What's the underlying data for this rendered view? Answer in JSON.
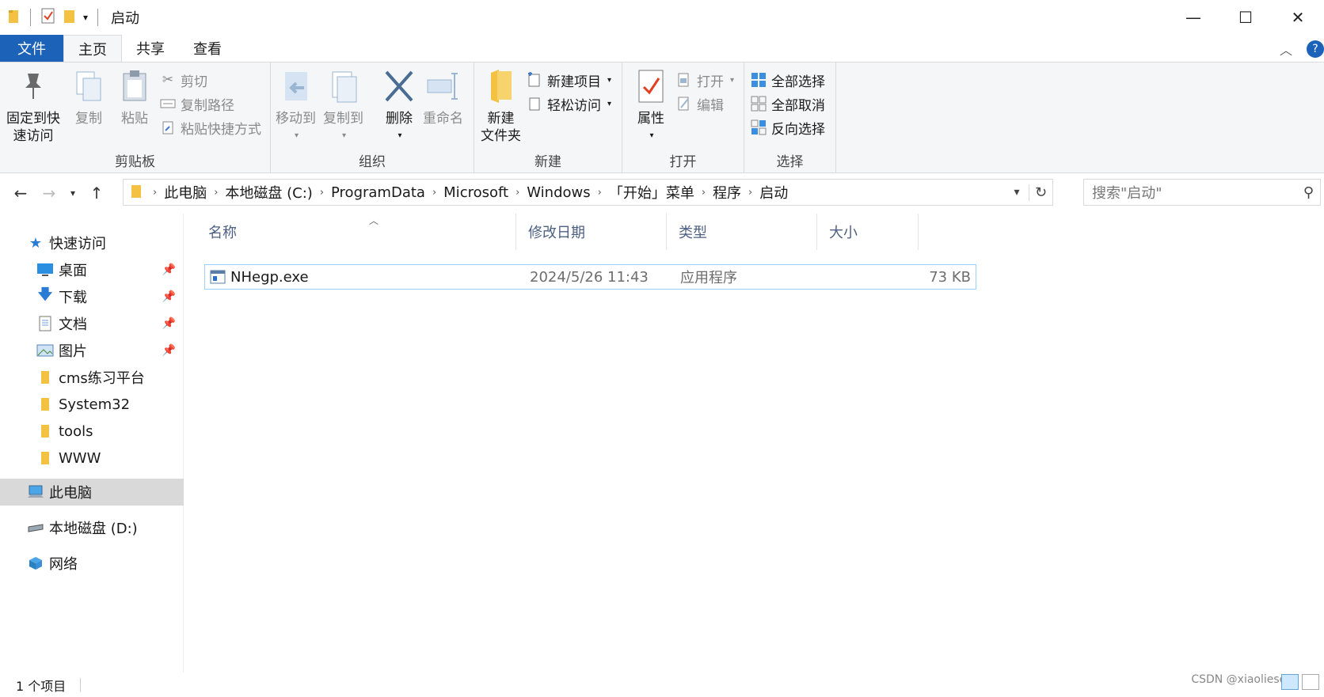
{
  "window": {
    "title": "启动",
    "controls": {
      "minimize": "—",
      "maximize": "☐",
      "close": "✕"
    }
  },
  "tabs": [
    {
      "label": "文件"
    },
    {
      "label": "主页"
    },
    {
      "label": "共享"
    },
    {
      "label": "查看"
    }
  ],
  "help": "?",
  "ribbon": {
    "clipboard": {
      "label": "剪贴板",
      "pin": "固定到快速访问",
      "pin_line1": "固定到快",
      "pin_line2": "速访问",
      "copy": "复制",
      "paste": "粘贴",
      "cut": "剪切",
      "copy_path": "复制路径",
      "paste_shortcut": "粘贴快捷方式"
    },
    "organize": {
      "label": "组织",
      "move_to": "移动到",
      "copy_to": "复制到",
      "delete": "删除",
      "rename": "重命名"
    },
    "new": {
      "label": "新建",
      "new_folder_line1": "新建",
      "new_folder_line2": "文件夹",
      "new_item": "新建项目",
      "easy_access": "轻松访问"
    },
    "open": {
      "label": "打开",
      "properties": "属性",
      "open": "打开",
      "edit": "编辑"
    },
    "select": {
      "label": "选择",
      "select_all": "全部选择",
      "select_none": "全部取消",
      "invert": "反向选择"
    }
  },
  "address": {
    "crumbs": [
      "此电脑",
      "本地磁盘 (C:)",
      "ProgramData",
      "Microsoft",
      "Windows",
      "「开始」菜单",
      "程序",
      "启动"
    ],
    "search_placeholder": "搜索\"启动\""
  },
  "navpane": {
    "quick_access": "快速访问",
    "pinned": [
      {
        "label": "桌面",
        "icon": "desktop-icon"
      },
      {
        "label": "下载",
        "icon": "download-icon"
      },
      {
        "label": "文档",
        "icon": "document-icon"
      },
      {
        "label": "图片",
        "icon": "pictures-icon"
      }
    ],
    "folders": [
      "cms练习平台",
      "System32",
      "tools",
      "WWW"
    ],
    "this_pc": "此电脑",
    "drive_d": "本地磁盘 (D:)",
    "network": "网络"
  },
  "columns": {
    "name": "名称",
    "modified": "修改日期",
    "type": "类型",
    "size": "大小"
  },
  "files": [
    {
      "name": "NHegp.exe",
      "modified": "2024/5/26 11:43",
      "type": "应用程序",
      "size": "73 KB"
    }
  ],
  "status": {
    "count": "1 个项目",
    "watermark": "CSDN @xiaoliesec"
  },
  "colors": {
    "accent": "#1c62b9",
    "folder": "#f3c242",
    "selection_border": "#99d1ff"
  }
}
